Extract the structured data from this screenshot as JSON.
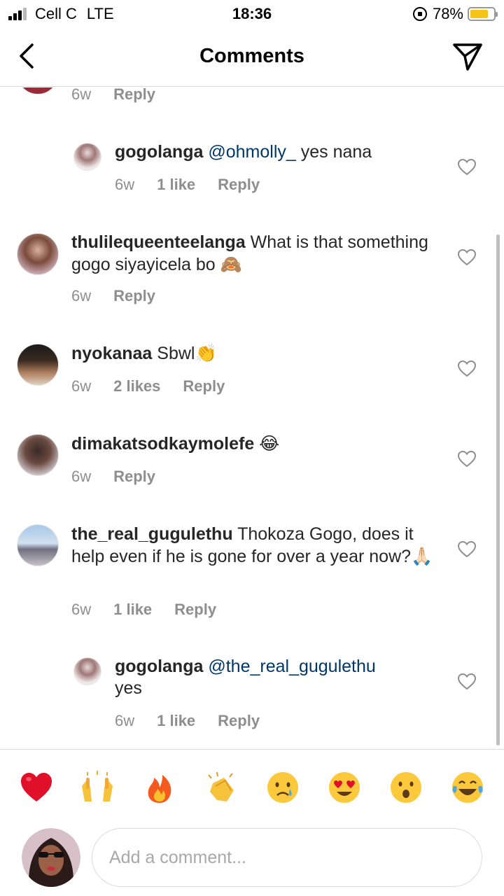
{
  "status_bar": {
    "carrier": "Cell C",
    "network": "LTE",
    "time": "18:36",
    "battery_percent": "78%",
    "battery_level": 0.78
  },
  "header": {
    "title": "Comments"
  },
  "comments": {
    "c0": {
      "time": "6w",
      "reply_label": "Reply"
    },
    "c1": {
      "username": "gogolanga",
      "mention": "@ohmolly_",
      "text": " yes nana",
      "time": "6w",
      "likes": "1 like",
      "reply_label": "Reply"
    },
    "c2": {
      "username": "thulilequeenteelanga",
      "text": " What is that something gogo siyayicela bo ",
      "emoji": "🙈",
      "time": "6w",
      "reply_label": "Reply"
    },
    "c3": {
      "username": "nyokanaa",
      "text": " Sbwl",
      "emoji": "👏",
      "time": "6w",
      "likes": "2 likes",
      "reply_label": "Reply"
    },
    "c4": {
      "username": "dimakatsodkaymolefe",
      "text": " ",
      "emoji": "😂",
      "time": "6w",
      "reply_label": "Reply"
    },
    "c5": {
      "username": "the_real_gugulethu",
      "text": " Thokoza Gogo, does it help even if he is gone for over a year now?",
      "emoji": "🙏🏻",
      "time": "6w",
      "likes": "1 like",
      "reply_label": "Reply"
    },
    "c6": {
      "username": "gogolanga",
      "mention": "@the_real_gugulethu",
      "text": " yes",
      "time": "6w",
      "likes": "1 like",
      "reply_label": "Reply"
    }
  },
  "quick_reactions": [
    "❤️",
    "🙌",
    "🔥",
    "👏",
    "😢",
    "😍",
    "😮",
    "😂"
  ],
  "composer": {
    "placeholder": "Add a comment..."
  },
  "colors": {
    "mention": "#00376b",
    "meta_gray": "#8e8e8e",
    "battery": "#f5c518"
  }
}
